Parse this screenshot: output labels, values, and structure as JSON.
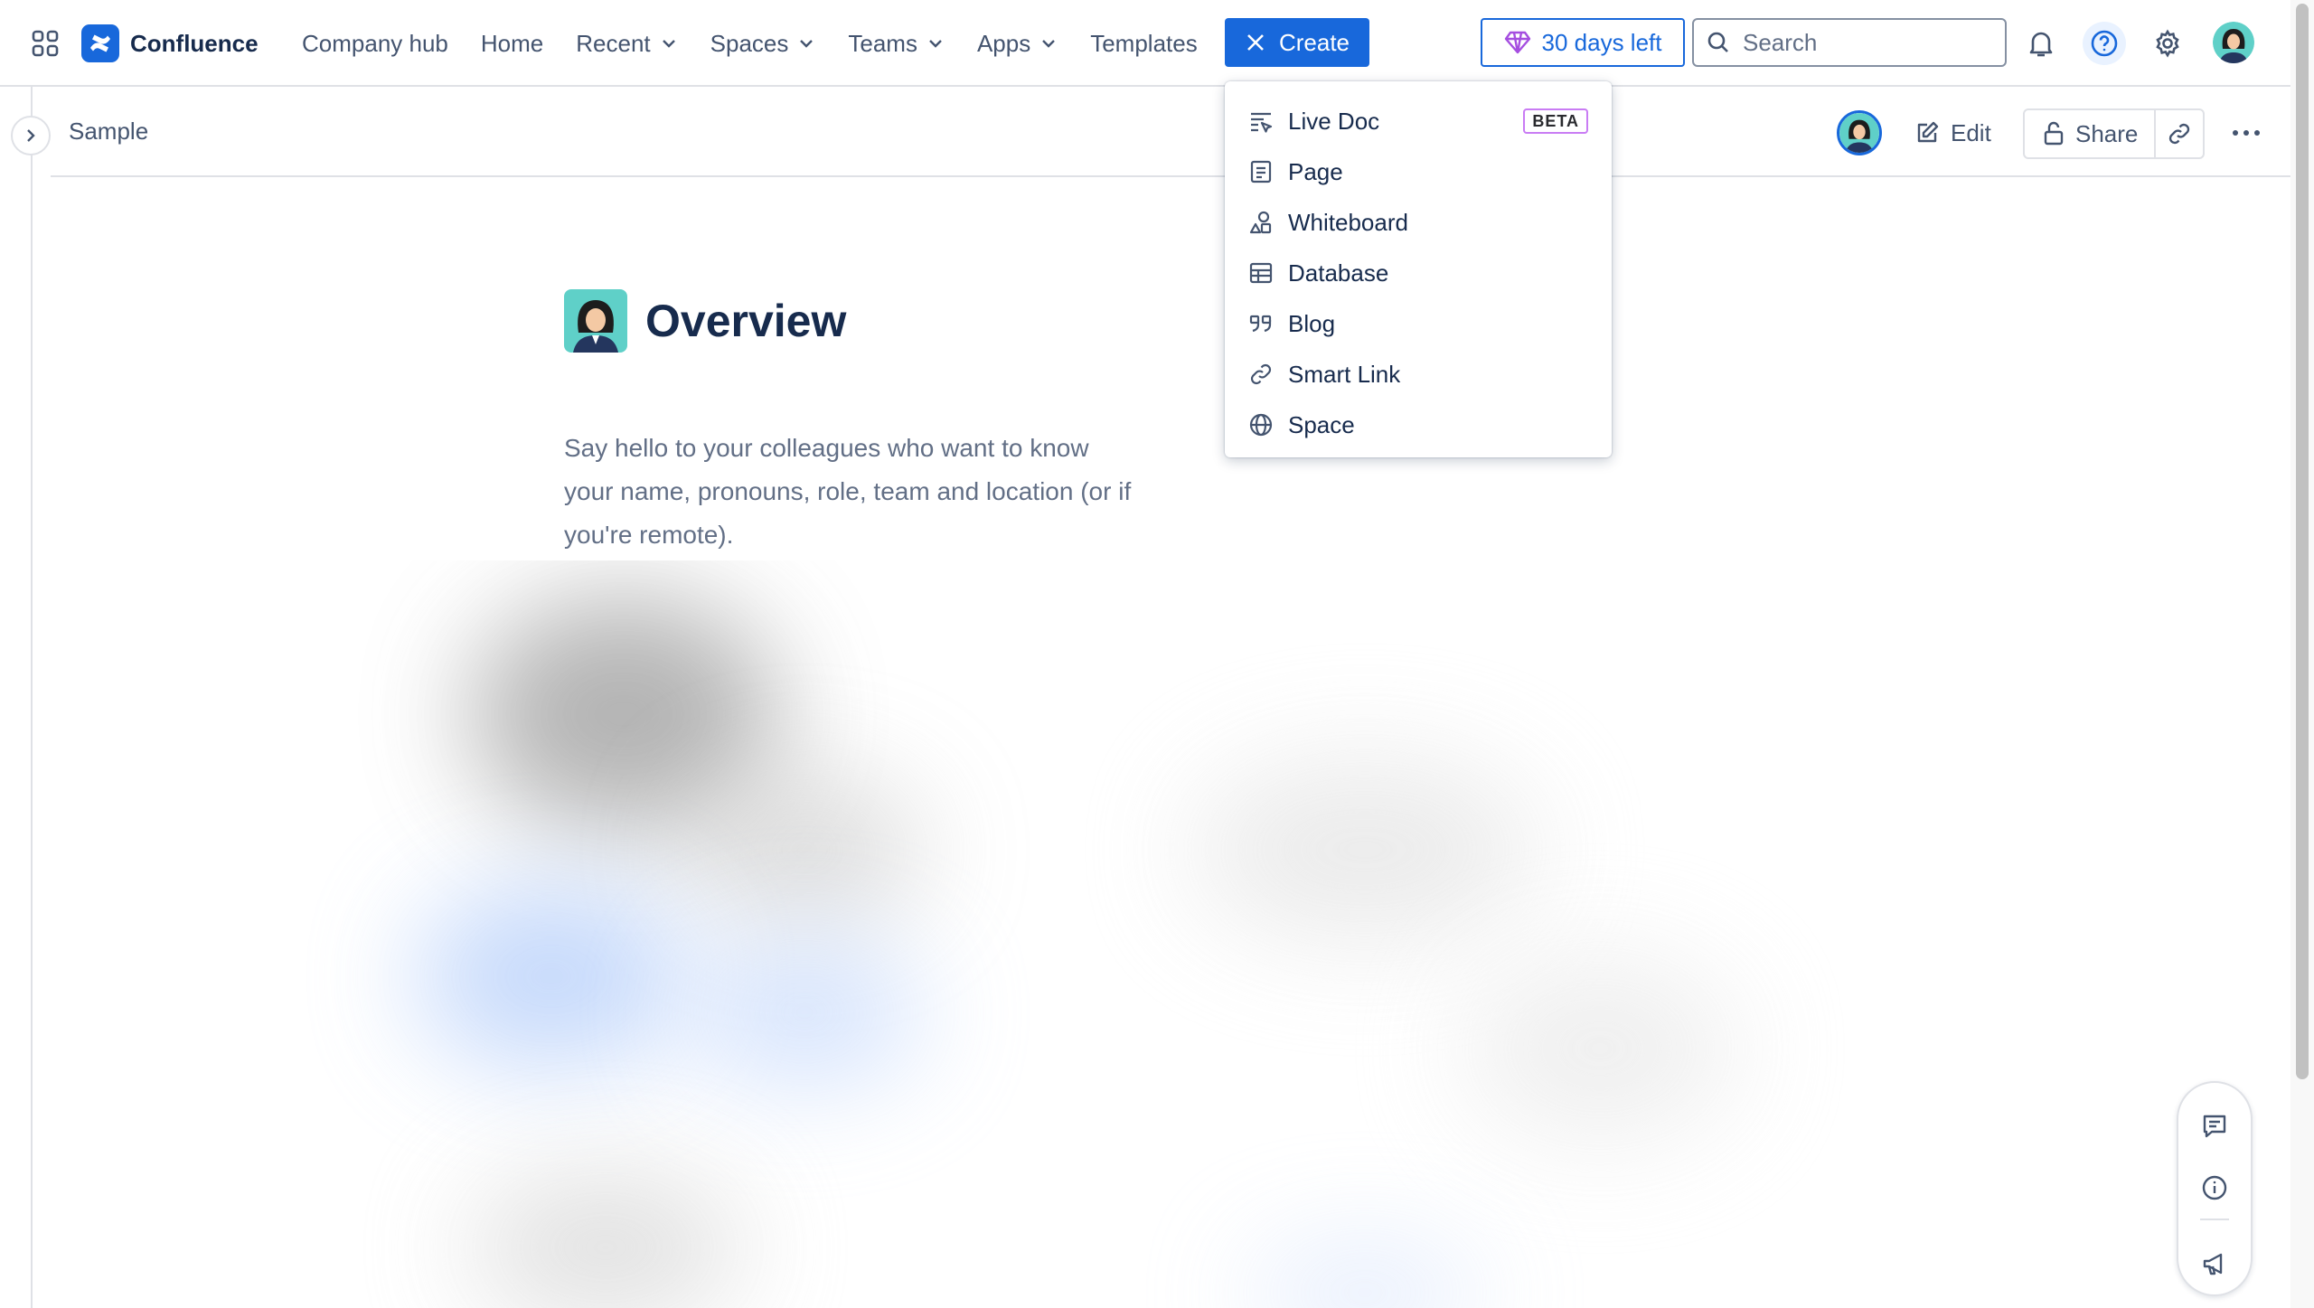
{
  "app": {
    "name": "Confluence"
  },
  "colors": {
    "brand": "#1868db",
    "text": "#172b4d",
    "subtle": "#44546f",
    "beta_border": "#c97cf4"
  },
  "nav": {
    "items": [
      {
        "label": "Company hub",
        "dropdown": false
      },
      {
        "label": "Home",
        "dropdown": false
      },
      {
        "label": "Recent",
        "dropdown": true
      },
      {
        "label": "Spaces",
        "dropdown": true
      },
      {
        "label": "Teams",
        "dropdown": true
      },
      {
        "label": "Apps",
        "dropdown": true
      },
      {
        "label": "Templates",
        "dropdown": false
      }
    ],
    "create_label": "Create",
    "trial_label": "30 days left",
    "search_placeholder": "Search"
  },
  "breadcrumb": {
    "space": "Sample"
  },
  "toolbar": {
    "edit_label": "Edit",
    "share_label": "Share"
  },
  "create_menu": {
    "items": [
      {
        "label": "Live Doc",
        "icon": "live-doc-icon",
        "badge": "BETA"
      },
      {
        "label": "Page",
        "icon": "page-icon"
      },
      {
        "label": "Whiteboard",
        "icon": "whiteboard-icon"
      },
      {
        "label": "Database",
        "icon": "database-icon"
      },
      {
        "label": "Blog",
        "icon": "blog-quote-icon"
      },
      {
        "label": "Smart Link",
        "icon": "smart-link-icon"
      },
      {
        "label": "Space",
        "icon": "globe-icon"
      }
    ]
  },
  "page": {
    "title": "Overview",
    "description": "Say hello to your colleagues who want to know your name, pronouns, role, team and location (or if you're remote)."
  }
}
